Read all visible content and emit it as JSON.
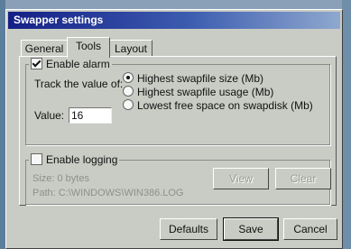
{
  "window": {
    "title": "Swapper settings"
  },
  "tabs": [
    {
      "label": "General"
    },
    {
      "label": "Tools"
    },
    {
      "label": "Layout"
    }
  ],
  "alarm": {
    "label": "Enable alarm",
    "checked": true,
    "track_label": "Track the value of:",
    "options": [
      {
        "label": "Highest swapfile size (Mb)",
        "selected": true
      },
      {
        "label": "Highest swapfile usage (Mb)",
        "selected": false
      },
      {
        "label": "Lowest free space on swapdisk (Mb)",
        "selected": false
      }
    ],
    "value_label": "Value:",
    "value": "16"
  },
  "logging": {
    "label": "Enable logging",
    "checked": false,
    "size_text": "Size: 0 bytes",
    "path_text": "Path: C:\\WINDOWS\\WIN386.LOG",
    "view_label": "View",
    "clear_label": "Clear"
  },
  "buttons": {
    "defaults": "Defaults",
    "save": "Save",
    "cancel": "Cancel"
  }
}
